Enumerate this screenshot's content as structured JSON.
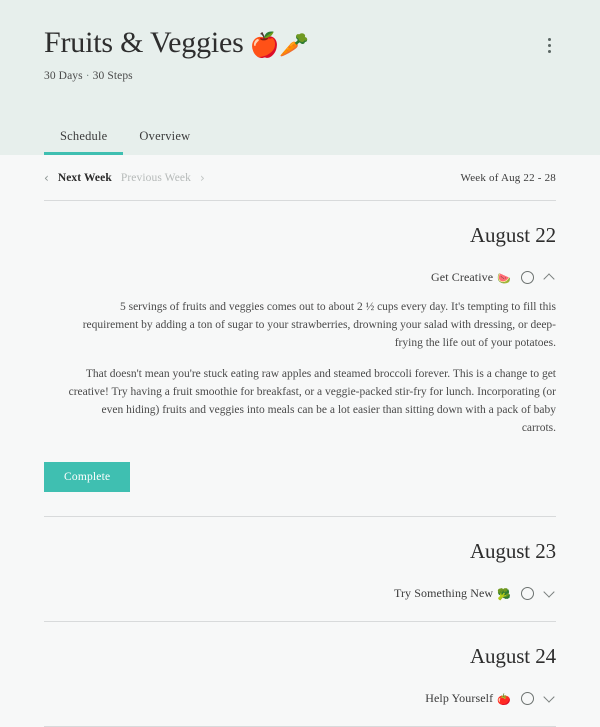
{
  "header": {
    "title": "Fruits & Veggies",
    "title_emojis": "🍎🥕",
    "days_label": "30 Days",
    "separator": "·",
    "steps_label": "30 Steps",
    "menu_icon": "kebab-menu-icon",
    "background_color": "#e7efec",
    "accent_color": "#3fbfb1"
  },
  "tabs": [
    {
      "label": "Schedule",
      "active": true
    },
    {
      "label": "Overview",
      "active": false
    }
  ],
  "week_nav": {
    "prev_chevron": "‹",
    "next_week_label": "Next Week",
    "previous_week_label": "Previous Week",
    "next_chevron": "›",
    "week_range": "Week of Aug 22 - 28"
  },
  "days": [
    {
      "date": "August 22",
      "step": {
        "title": "Get Creative",
        "emoji": "🍉",
        "expanded": true,
        "checked": false,
        "toggle_icon": "chevron-up-icon",
        "paragraphs": [
          "5 servings of fruits and veggies comes out to about 2 ½ cups every day. It's tempting to fill this requirement by adding a ton of sugar to your strawberries, drowning your salad with dressing, or deep-frying the life out of your potatoes.",
          "That doesn't mean you're stuck eating raw apples and steamed broccoli forever. This is a change to get creative! Try having a fruit smoothie for breakfast, or a veggie-packed stir-fry for lunch. Incorporating (or even hiding) fruits and veggies into meals can be a lot easier than sitting down with a pack of baby carrots."
        ],
        "complete_label": "Complete"
      }
    },
    {
      "date": "August 23",
      "step": {
        "title": "Try Something New",
        "emoji": "🥦",
        "expanded": false,
        "checked": false,
        "toggle_icon": "chevron-down-icon",
        "paragraphs": [],
        "complete_label": ""
      }
    },
    {
      "date": "August 24",
      "step": {
        "title": "Help Yourself",
        "emoji": "🍅",
        "expanded": false,
        "checked": false,
        "toggle_icon": "chevron-down-icon",
        "paragraphs": [],
        "complete_label": ""
      }
    }
  ]
}
